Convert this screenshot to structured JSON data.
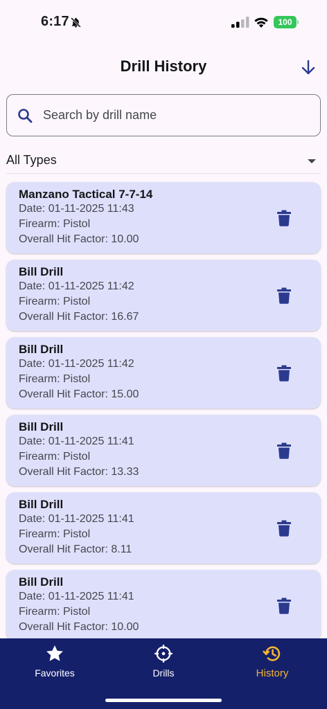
{
  "status_bar": {
    "time": "6:17",
    "battery": "100"
  },
  "header": {
    "title": "Drill History"
  },
  "search": {
    "placeholder": "Search by drill name",
    "value": ""
  },
  "filter": {
    "selected": "All Types"
  },
  "drills": [
    {
      "name": "Manzano Tactical 7-7-14",
      "date": "Date: 01-11-2025 11:43",
      "firearm": "Firearm: Pistol",
      "hit_factor": "Overall Hit Factor: 10.00"
    },
    {
      "name": "Bill Drill",
      "date": "Date: 01-11-2025 11:42",
      "firearm": "Firearm: Pistol",
      "hit_factor": "Overall Hit Factor: 16.67"
    },
    {
      "name": "Bill Drill",
      "date": "Date: 01-11-2025 11:42",
      "firearm": "Firearm: Pistol",
      "hit_factor": "Overall Hit Factor: 15.00"
    },
    {
      "name": "Bill Drill",
      "date": "Date: 01-11-2025 11:41",
      "firearm": "Firearm: Pistol",
      "hit_factor": "Overall Hit Factor: 13.33"
    },
    {
      "name": "Bill Drill",
      "date": "Date: 01-11-2025 11:41",
      "firearm": "Firearm: Pistol",
      "hit_factor": "Overall Hit Factor: 8.11"
    },
    {
      "name": "Bill Drill",
      "date": "Date: 01-11-2025 11:41",
      "firearm": "Firearm: Pistol",
      "hit_factor": "Overall Hit Factor: 10.00"
    }
  ],
  "nav": {
    "items": [
      {
        "label": "Favorites",
        "icon": "star-icon"
      },
      {
        "label": "Drills",
        "icon": "crosshair-icon"
      },
      {
        "label": "History",
        "icon": "history-icon"
      }
    ],
    "active": "History"
  },
  "colors": {
    "background": "#fdf7fd",
    "card": "#dee0fb",
    "accent": "#2b3a8f",
    "nav_bg": "#15206b",
    "nav_active": "#f5b631",
    "battery": "#34c759"
  }
}
